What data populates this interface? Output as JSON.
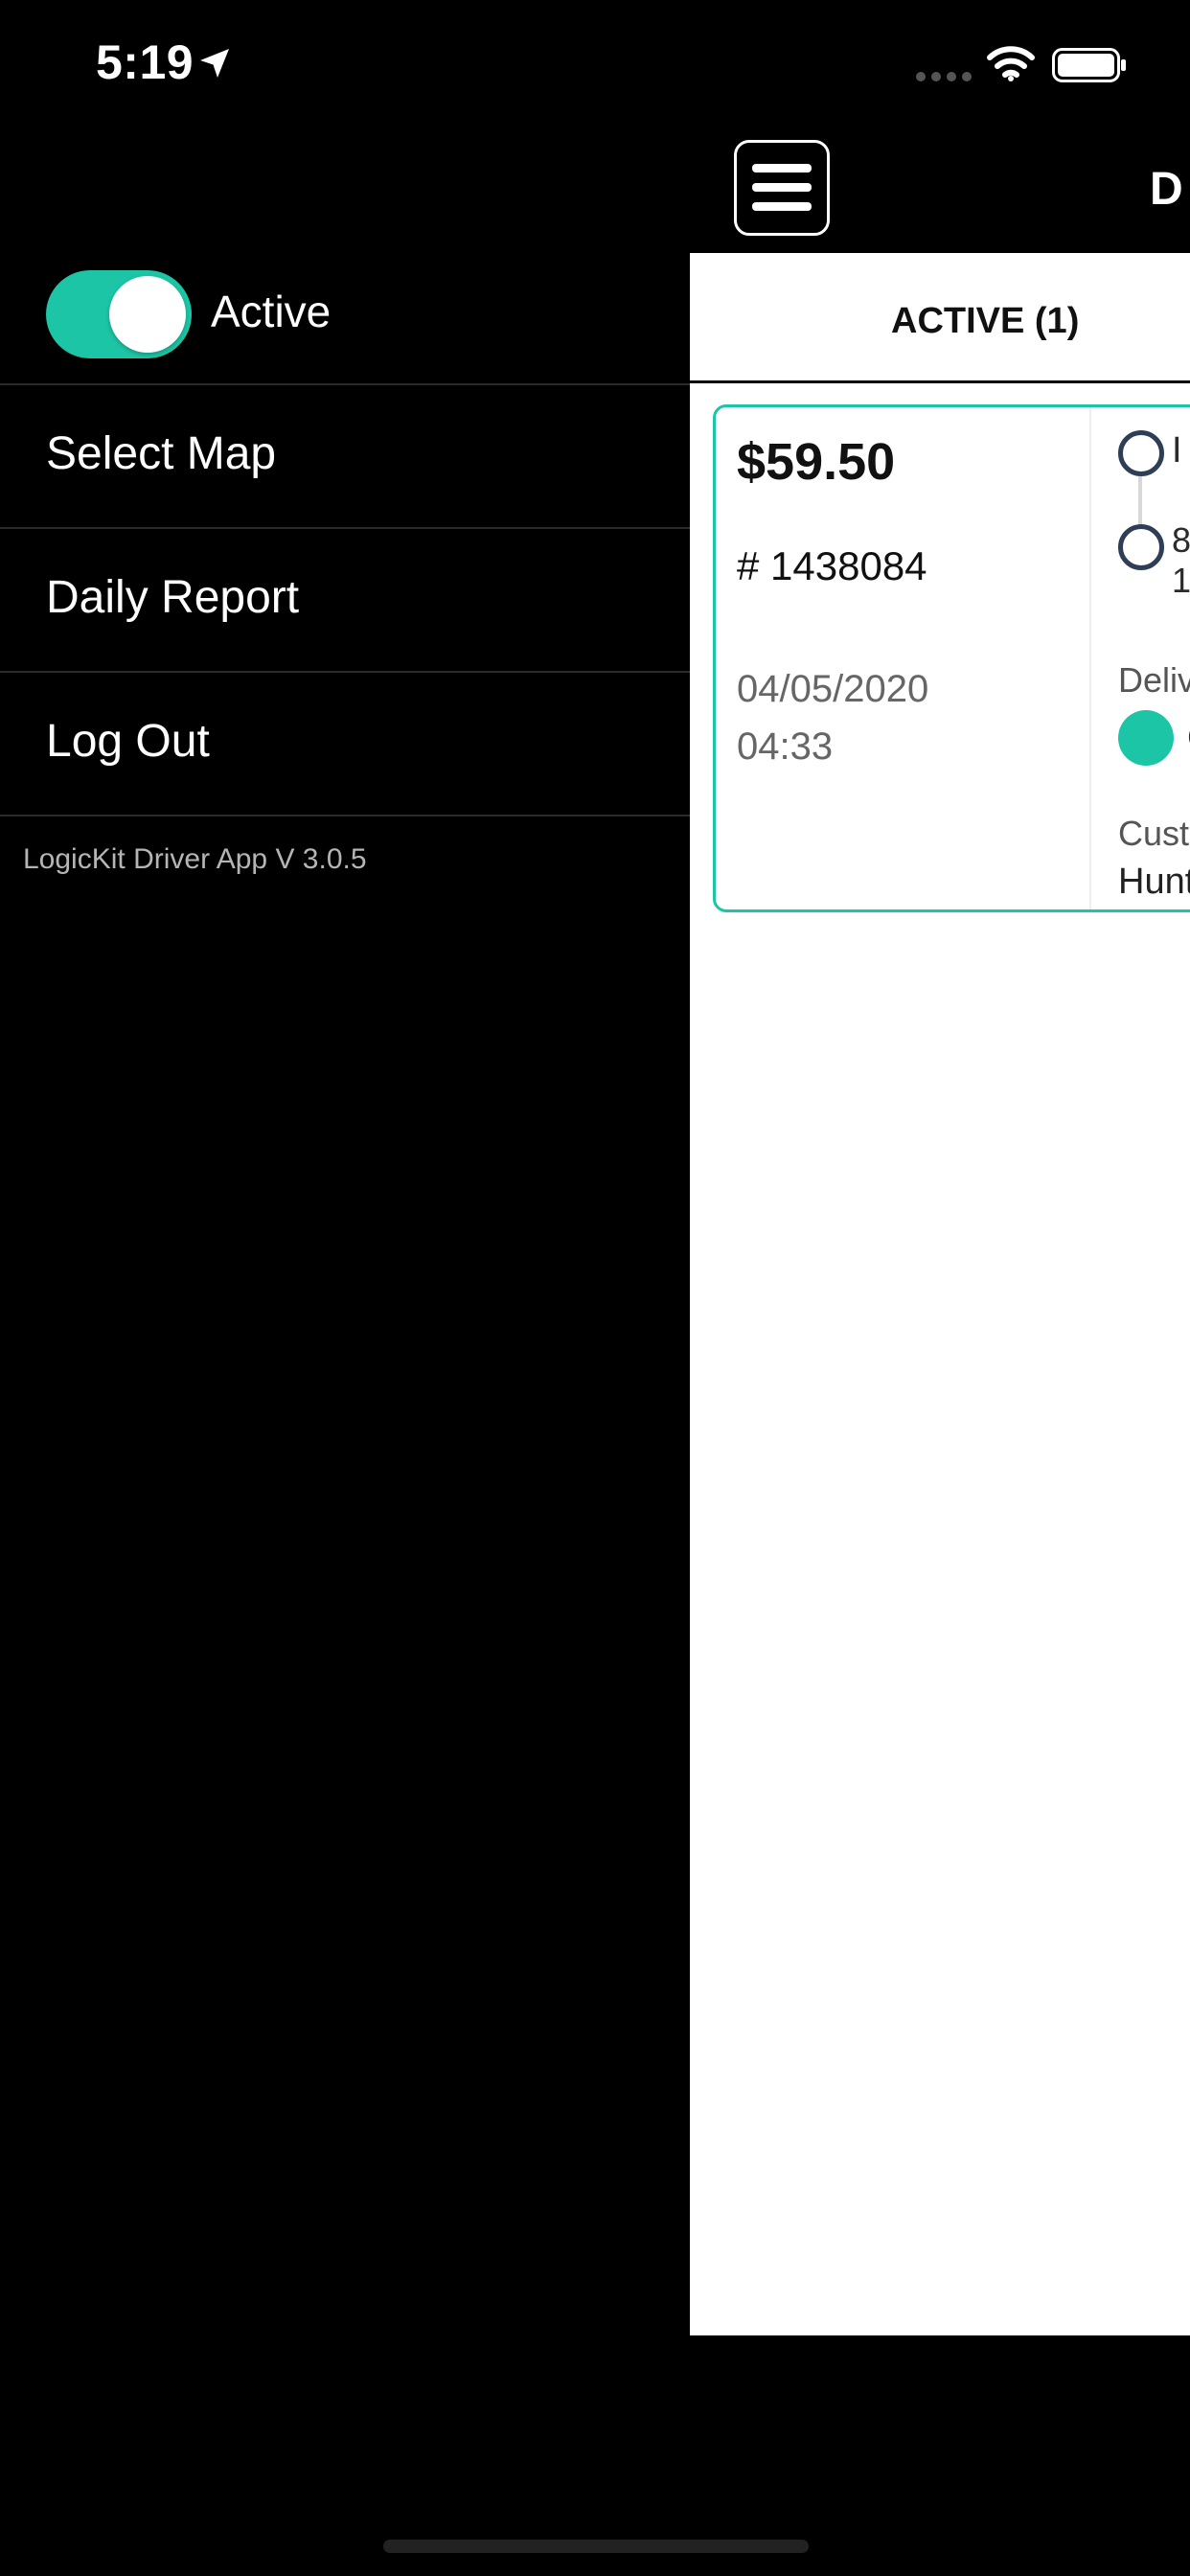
{
  "status_bar": {
    "time": "5:19",
    "icons": [
      "location-arrow-icon",
      "signal-icon",
      "wifi-icon",
      "battery-icon"
    ]
  },
  "drawer": {
    "active_toggle": {
      "label": "Active",
      "on": true
    },
    "menu_items": [
      {
        "label": "Select Map"
      },
      {
        "label": "Daily Report"
      },
      {
        "label": "Log Out"
      }
    ],
    "version": "LogicKit Driver App V  3.0.5"
  },
  "main": {
    "menu_icon": "hamburger-menu-icon",
    "title_partial": "D",
    "tabs": [
      {
        "label": "ACTIVE (1)",
        "selected": true
      }
    ],
    "orders": [
      {
        "price": "$59.50",
        "order_number": "# 1438084",
        "date": "04/05/2020",
        "time": "04:33",
        "stop1_partial": "I",
        "stop2_partial_line1": "8",
        "stop2_partial_line2": "1",
        "delivery_label_partial": "Deliv",
        "delivery_status_partial": "C",
        "customer_label_partial": "Custo",
        "customer_name_partial": "Hunt"
      }
    ]
  },
  "colors": {
    "accent": "#1cc5a5",
    "background": "#000000",
    "content_background": "#ffffff",
    "ring": "#2e3e56"
  }
}
